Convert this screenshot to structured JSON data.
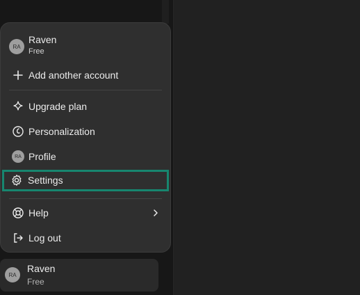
{
  "account": {
    "name": "Raven",
    "plan": "Free",
    "initials": "RA"
  },
  "menu": {
    "add_account": "Add another account",
    "upgrade": "Upgrade plan",
    "personalization": "Personalization",
    "profile": "Profile",
    "settings": "Settings",
    "help": "Help",
    "logout": "Log out"
  },
  "footer_user": {
    "name": "Raven",
    "plan": "Free",
    "initials": "RA"
  },
  "colors": {
    "highlight": "#17866f",
    "menu_bg": "#2f2f2f",
    "sidebar_bg": "#171717"
  }
}
